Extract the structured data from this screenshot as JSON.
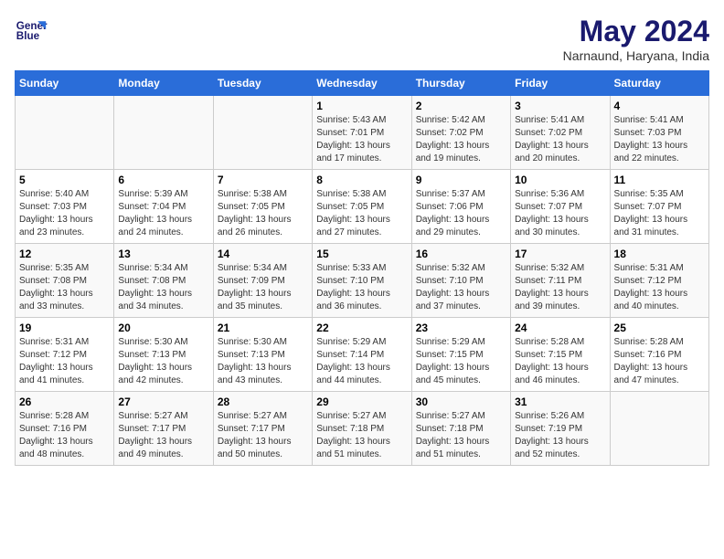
{
  "logo": {
    "line1": "General",
    "line2": "Blue"
  },
  "title": "May 2024",
  "location": "Narnaund, Haryana, India",
  "headers": [
    "Sunday",
    "Monday",
    "Tuesday",
    "Wednesday",
    "Thursday",
    "Friday",
    "Saturday"
  ],
  "weeks": [
    [
      {
        "day": "",
        "info": ""
      },
      {
        "day": "",
        "info": ""
      },
      {
        "day": "",
        "info": ""
      },
      {
        "day": "1",
        "info": "Sunrise: 5:43 AM\nSunset: 7:01 PM\nDaylight: 13 hours\nand 17 minutes."
      },
      {
        "day": "2",
        "info": "Sunrise: 5:42 AM\nSunset: 7:02 PM\nDaylight: 13 hours\nand 19 minutes."
      },
      {
        "day": "3",
        "info": "Sunrise: 5:41 AM\nSunset: 7:02 PM\nDaylight: 13 hours\nand 20 minutes."
      },
      {
        "day": "4",
        "info": "Sunrise: 5:41 AM\nSunset: 7:03 PM\nDaylight: 13 hours\nand 22 minutes."
      }
    ],
    [
      {
        "day": "5",
        "info": "Sunrise: 5:40 AM\nSunset: 7:03 PM\nDaylight: 13 hours\nand 23 minutes."
      },
      {
        "day": "6",
        "info": "Sunrise: 5:39 AM\nSunset: 7:04 PM\nDaylight: 13 hours\nand 24 minutes."
      },
      {
        "day": "7",
        "info": "Sunrise: 5:38 AM\nSunset: 7:05 PM\nDaylight: 13 hours\nand 26 minutes."
      },
      {
        "day": "8",
        "info": "Sunrise: 5:38 AM\nSunset: 7:05 PM\nDaylight: 13 hours\nand 27 minutes."
      },
      {
        "day": "9",
        "info": "Sunrise: 5:37 AM\nSunset: 7:06 PM\nDaylight: 13 hours\nand 29 minutes."
      },
      {
        "day": "10",
        "info": "Sunrise: 5:36 AM\nSunset: 7:07 PM\nDaylight: 13 hours\nand 30 minutes."
      },
      {
        "day": "11",
        "info": "Sunrise: 5:35 AM\nSunset: 7:07 PM\nDaylight: 13 hours\nand 31 minutes."
      }
    ],
    [
      {
        "day": "12",
        "info": "Sunrise: 5:35 AM\nSunset: 7:08 PM\nDaylight: 13 hours\nand 33 minutes."
      },
      {
        "day": "13",
        "info": "Sunrise: 5:34 AM\nSunset: 7:08 PM\nDaylight: 13 hours\nand 34 minutes."
      },
      {
        "day": "14",
        "info": "Sunrise: 5:34 AM\nSunset: 7:09 PM\nDaylight: 13 hours\nand 35 minutes."
      },
      {
        "day": "15",
        "info": "Sunrise: 5:33 AM\nSunset: 7:10 PM\nDaylight: 13 hours\nand 36 minutes."
      },
      {
        "day": "16",
        "info": "Sunrise: 5:32 AM\nSunset: 7:10 PM\nDaylight: 13 hours\nand 37 minutes."
      },
      {
        "day": "17",
        "info": "Sunrise: 5:32 AM\nSunset: 7:11 PM\nDaylight: 13 hours\nand 39 minutes."
      },
      {
        "day": "18",
        "info": "Sunrise: 5:31 AM\nSunset: 7:12 PM\nDaylight: 13 hours\nand 40 minutes."
      }
    ],
    [
      {
        "day": "19",
        "info": "Sunrise: 5:31 AM\nSunset: 7:12 PM\nDaylight: 13 hours\nand 41 minutes."
      },
      {
        "day": "20",
        "info": "Sunrise: 5:30 AM\nSunset: 7:13 PM\nDaylight: 13 hours\nand 42 minutes."
      },
      {
        "day": "21",
        "info": "Sunrise: 5:30 AM\nSunset: 7:13 PM\nDaylight: 13 hours\nand 43 minutes."
      },
      {
        "day": "22",
        "info": "Sunrise: 5:29 AM\nSunset: 7:14 PM\nDaylight: 13 hours\nand 44 minutes."
      },
      {
        "day": "23",
        "info": "Sunrise: 5:29 AM\nSunset: 7:15 PM\nDaylight: 13 hours\nand 45 minutes."
      },
      {
        "day": "24",
        "info": "Sunrise: 5:28 AM\nSunset: 7:15 PM\nDaylight: 13 hours\nand 46 minutes."
      },
      {
        "day": "25",
        "info": "Sunrise: 5:28 AM\nSunset: 7:16 PM\nDaylight: 13 hours\nand 47 minutes."
      }
    ],
    [
      {
        "day": "26",
        "info": "Sunrise: 5:28 AM\nSunset: 7:16 PM\nDaylight: 13 hours\nand 48 minutes."
      },
      {
        "day": "27",
        "info": "Sunrise: 5:27 AM\nSunset: 7:17 PM\nDaylight: 13 hours\nand 49 minutes."
      },
      {
        "day": "28",
        "info": "Sunrise: 5:27 AM\nSunset: 7:17 PM\nDaylight: 13 hours\nand 50 minutes."
      },
      {
        "day": "29",
        "info": "Sunrise: 5:27 AM\nSunset: 7:18 PM\nDaylight: 13 hours\nand 51 minutes."
      },
      {
        "day": "30",
        "info": "Sunrise: 5:27 AM\nSunset: 7:18 PM\nDaylight: 13 hours\nand 51 minutes."
      },
      {
        "day": "31",
        "info": "Sunrise: 5:26 AM\nSunset: 7:19 PM\nDaylight: 13 hours\nand 52 minutes."
      },
      {
        "day": "",
        "info": ""
      }
    ]
  ]
}
